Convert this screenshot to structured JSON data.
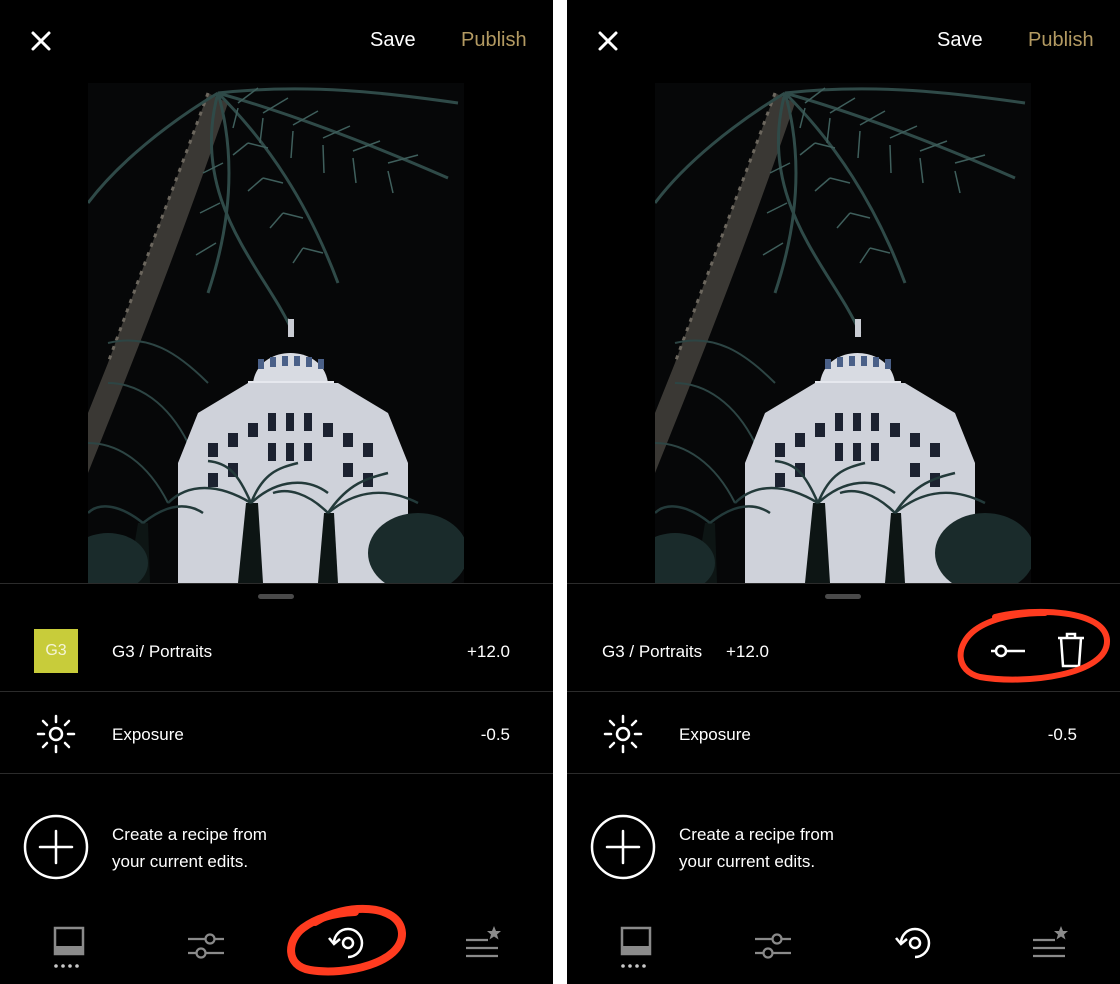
{
  "header": {
    "save_label": "Save",
    "publish_label": "Publish"
  },
  "left": {
    "preset": {
      "badge": "G3",
      "label": "G3 / Portraits",
      "value": "+12.0"
    },
    "exposure": {
      "label": "Exposure",
      "value": "-0.5"
    },
    "recipe": {
      "line1": "Create a recipe from",
      "line2": "your current edits."
    },
    "active_tab": "recipes"
  },
  "right": {
    "preset": {
      "label": "G3 / Portraits",
      "value": "+12.0"
    },
    "exposure": {
      "label": "Exposure",
      "value": "-0.5"
    },
    "recipe": {
      "line1": "Create a recipe from",
      "line2": "your current edits."
    },
    "active_tab": "recipes"
  },
  "icons": [
    "close-icon",
    "sun-icon",
    "plus-icon",
    "presets-tab-icon",
    "tools-tab-icon",
    "recipes-tab-icon",
    "favorites-tab-icon",
    "slider-icon",
    "trash-icon"
  ],
  "colors": {
    "publish": "#b39a62",
    "badge": "#c8cc3a",
    "annotation": "#ff3b1f",
    "background": "#000000"
  }
}
